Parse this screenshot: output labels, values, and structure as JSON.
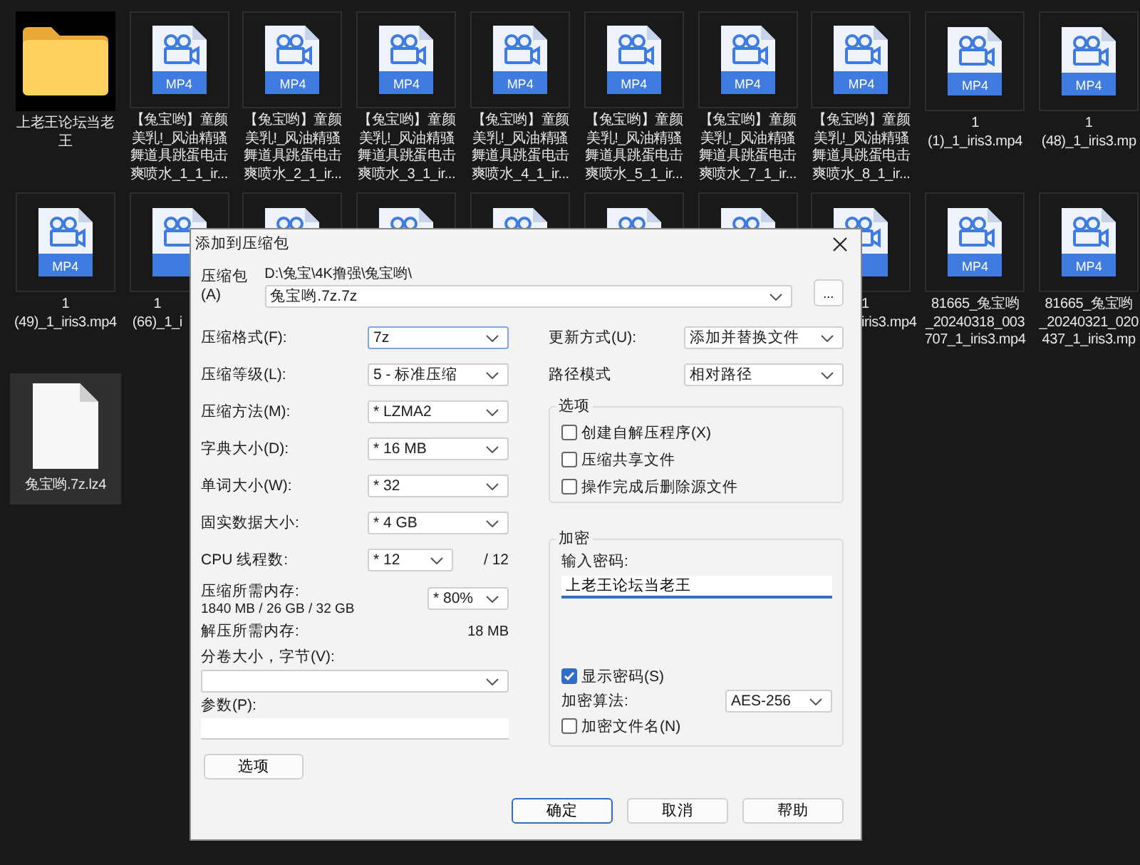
{
  "explorer": {
    "rows": [
      [
        {
          "kind": "folder",
          "lines": [
            "上老王论坛当老",
            "王"
          ],
          "selected": false
        },
        {
          "kind": "video",
          "badge": "MP4",
          "lines": [
            "【兔宝哟】童颜",
            "美乳!_风油精骚",
            "舞道具跳蛋电击",
            "爽喷水_1_1_ir..."
          ],
          "selected": false
        },
        {
          "kind": "video",
          "badge": "MP4",
          "lines": [
            "【兔宝哟】童颜",
            "美乳!_风油精骚",
            "舞道具跳蛋电击",
            "爽喷水_2_1_ir..."
          ],
          "selected": false
        },
        {
          "kind": "video",
          "badge": "MP4",
          "lines": [
            "【兔宝哟】童颜",
            "美乳!_风油精骚",
            "舞道具跳蛋电击",
            "爽喷水_3_1_ir..."
          ],
          "selected": false
        },
        {
          "kind": "video",
          "badge": "MP4",
          "lines": [
            "【兔宝哟】童颜",
            "美乳!_风油精骚",
            "舞道具跳蛋电击",
            "爽喷水_4_1_ir..."
          ],
          "selected": false
        },
        {
          "kind": "video",
          "badge": "MP4",
          "lines": [
            "【兔宝哟】童颜",
            "美乳!_风油精骚",
            "舞道具跳蛋电击",
            "爽喷水_5_1_ir..."
          ],
          "selected": false
        },
        {
          "kind": "video",
          "badge": "MP4",
          "lines": [
            "【兔宝哟】童颜",
            "美乳!_风油精骚",
            "舞道具跳蛋电击",
            "爽喷水_7_1_ir..."
          ],
          "selected": false
        },
        {
          "kind": "video",
          "badge": "MP4",
          "lines": [
            "【兔宝哟】童颜",
            "美乳!_风油精骚",
            "舞道具跳蛋电击",
            "爽喷水_8_1_ir..."
          ],
          "selected": false
        },
        {
          "kind": "video",
          "badge": "MP4",
          "lines": [
            "1",
            "(1)_1_iris3.mp4"
          ],
          "selected": false
        },
        {
          "kind": "video",
          "badge": "MP4",
          "lines": [
            "1",
            "(48)_1_iris3.mp"
          ],
          "selected": false
        }
      ],
      [
        {
          "kind": "video",
          "badge": "MP4",
          "lines": [
            "1",
            "(49)_1_iris3.mp4"
          ],
          "selected": false
        },
        {
          "kind": "video",
          "lines": [
            "1",
            "(66)_1_i"
          ],
          "selected": false
        },
        {
          "kind": "video",
          "selected": false
        },
        {
          "kind": "video",
          "selected": false
        },
        {
          "kind": "video",
          "selected": false
        },
        {
          "kind": "video",
          "selected": false
        },
        {
          "kind": "video",
          "selected": false
        },
        {
          "kind": "video",
          "lines": [
            "1",
            "iris3.mp4"
          ],
          "selected": false
        },
        {
          "kind": "video",
          "badge": "MP4",
          "lines": [
            "81665_兔宝哟",
            "_20240318_003",
            "707_1_iris3.mp4"
          ],
          "selected": false
        },
        {
          "kind": "video",
          "badge": "MP4",
          "lines": [
            "81665_兔宝哟",
            "_20240321_020",
            "437_1_iris3.mp"
          ],
          "selected": false
        }
      ],
      [
        {
          "kind": "document",
          "lines": [
            "兔宝哟.7z.lz4"
          ],
          "selected": true
        }
      ]
    ]
  },
  "dialog": {
    "title": "添加到压缩包",
    "archive": {
      "label": "压缩包(A)",
      "path": "D:\\兔宝\\4K撸强\\兔宝哟\\",
      "value": "兔宝哟.7z.7z",
      "browse": "..."
    },
    "left_fields": [
      {
        "kind": "combo",
        "label": "压缩格式(F):",
        "value": "7z",
        "focused": true
      },
      {
        "kind": "combo",
        "label": "压缩等级(L):",
        "value": "5 - 标准压缩",
        "focused": false
      },
      {
        "kind": "combo",
        "label": "压缩方法(M):",
        "value": "* LZMA2",
        "focused": false
      },
      {
        "kind": "combo",
        "label": "字典大小(D):",
        "value": "* 16 MB",
        "focused": false
      },
      {
        "kind": "combo",
        "label": "单词大小(W):",
        "value": "* 32",
        "focused": false
      },
      {
        "kind": "combo",
        "label": "固实数据大小:",
        "value": "* 4 GB",
        "focused": false
      },
      {
        "kind": "threads",
        "label": "CPU 线程数:",
        "value": "* 12",
        "suffix": "/ 12",
        "focused": false
      },
      {
        "kind": "memory",
        "label": "压缩所需内存:",
        "detail": "1840 MB / 26 GB / 32 GB",
        "value": "* 80%",
        "focused": false
      },
      {
        "kind": "info",
        "label": "解压所需内存:",
        "value": "18 MB"
      },
      {
        "kind": "stacked-combo",
        "label": "分卷大小，字节(V):",
        "focused": false
      },
      {
        "kind": "stacked-input",
        "label": "参数(P):"
      }
    ],
    "options_button": "选项",
    "right_fields": [
      {
        "label": "更新方式(U):",
        "value": "添加并替换文件",
        "focused": false
      },
      {
        "label": "路径模式",
        "value": "相对路径",
        "focused": false
      }
    ],
    "options_group": {
      "title": "选项",
      "checkboxes": [
        {
          "label": "创建自解压程序(X)",
          "checked": false
        },
        {
          "label": "压缩共享文件",
          "checked": false
        },
        {
          "label": "操作完成后删除源文件",
          "checked": false
        }
      ]
    },
    "encryption": {
      "title": "加密",
      "password_label": "输入密码:",
      "password": "上老王论坛当老王",
      "show_password": {
        "label": "显示密码(S)",
        "checked": true
      },
      "method_label": "加密算法:",
      "method": "AES-256",
      "encrypt_names": {
        "label": "加密文件名(N)",
        "checked": false
      }
    },
    "buttons": [
      {
        "label": "确定",
        "default": true
      },
      {
        "label": "取消",
        "default": false
      },
      {
        "label": "帮助",
        "default": false
      }
    ]
  }
}
